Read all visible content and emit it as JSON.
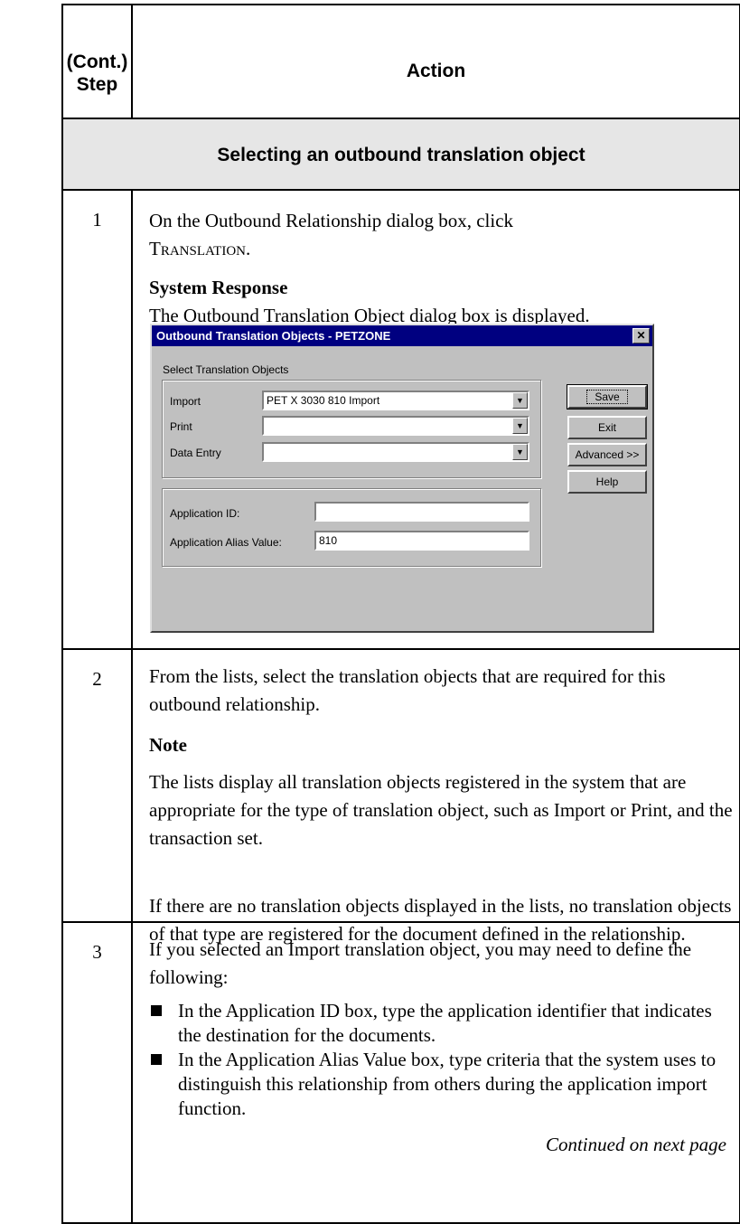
{
  "header": {
    "step_line1": "(Cont.)",
    "step_line2": "Step",
    "action": "Action"
  },
  "section_title": "Selecting an outbound translation object",
  "step1": {
    "num": "1",
    "line1": "On the Outbound Relationship dialog box, click",
    "button_ref": "Translation",
    "button_ref_suffix": ".",
    "subhead": "System Response",
    "response": "The Outbound Translation Object dialog box is displayed."
  },
  "dialog": {
    "title": "Outbound Translation Objects - PETZONE",
    "close": "✕",
    "group_label": "Select Translation Objects",
    "import_label": "Import",
    "import_value": "PET X 3030 810 Import",
    "print_label": "Print",
    "print_value": "",
    "data_entry_label": "Data Entry",
    "data_entry_value": "",
    "app_id_label": "Application ID:",
    "app_id_value": "",
    "alias_label": "Application Alias Value:",
    "alias_value": "810",
    "save": "Save",
    "exit": "Exit",
    "advanced": "Advanced >>",
    "help": "Help",
    "dropdown_icon": "▼"
  },
  "step2": {
    "num": "2",
    "text": "From the lists, select the translation objects that are required for this outbound relationship.",
    "subhead": "Note",
    "note": "The lists display all translation objects registered in the system that are appropriate for the type of translation object, such as Import or Print, and the transaction set.",
    "note2": "If there are no translation objects displayed in the lists, no translation objects of that type are registered for the document defined in the relationship."
  },
  "step3": {
    "num": "3",
    "text": "If you selected an Import translation object, you may need to define the following:",
    "bullets": [
      "In the Application ID box, type the application identifier that indicates the destination for the documents.",
      "In the Application Alias Value box, type criteria that the system uses to distinguish this relationship from others during the application import function."
    ],
    "continued": "Continued on next page"
  }
}
